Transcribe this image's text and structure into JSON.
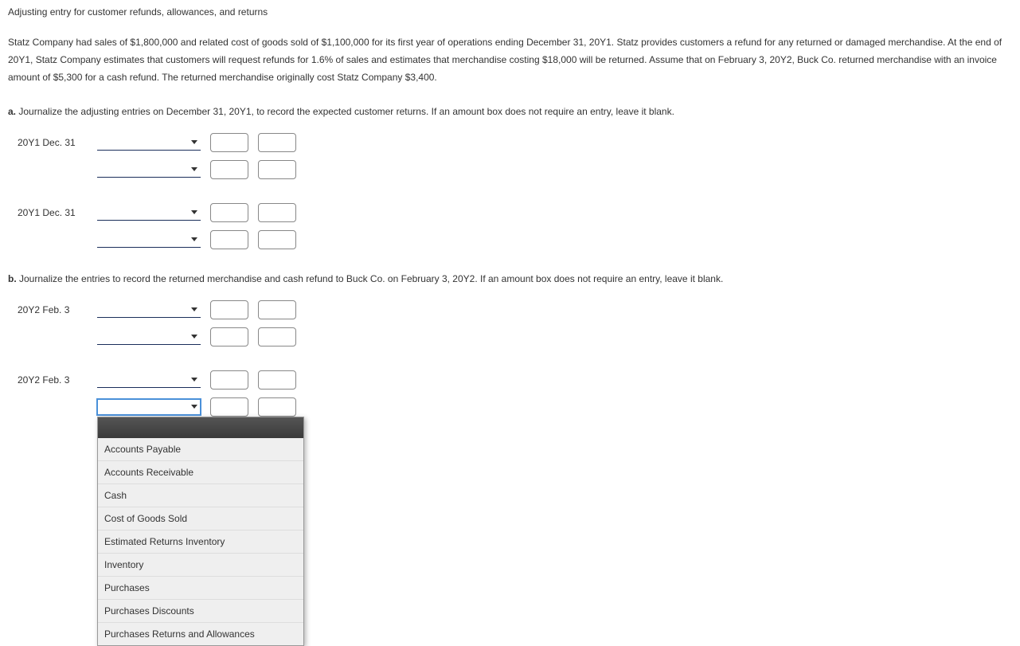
{
  "title": "Adjusting entry for customer refunds, allowances, and returns",
  "problem_text": "Statz Company had sales of $1,800,000 and related cost of goods sold of $1,100,000 for its first year of operations ending December 31, 20Y1. Statz provides customers a refund for any returned or damaged merchandise. At the end of 20Y1, Statz Company estimates that customers will request refunds for 1.6% of sales and estimates that merchandise costing $18,000 will be returned. Assume that on February 3, 20Y2, Buck Co. returned merchandise with an invoice amount of $5,300 for a cash refund. The returned merchandise originally cost Statz Company $3,400.",
  "partA": {
    "label": "a.",
    "text": " Journalize the adjusting entries on December 31, 20Y1, to record the expected customer returns. If an amount box does not require an entry, leave it blank.",
    "entries": [
      {
        "date": "20Y1 Dec. 31"
      },
      {
        "date": "20Y1 Dec. 31"
      }
    ]
  },
  "partB": {
    "label": "b.",
    "text": " Journalize the entries to record the returned merchandise and cash refund to Buck Co. on February 3, 20Y2. If an amount box does not require an entry, leave it blank.",
    "entries": [
      {
        "date": "20Y2 Feb. 3"
      },
      {
        "date": "20Y2 Feb. 3"
      }
    ]
  },
  "dropdown": {
    "options": [
      "Accounts Payable",
      "Accounts Receivable",
      "Cash",
      "Cost of Goods Sold",
      "Estimated Returns Inventory",
      "Inventory",
      "Purchases",
      "Purchases Discounts",
      "Purchases Returns and Allowances"
    ]
  }
}
